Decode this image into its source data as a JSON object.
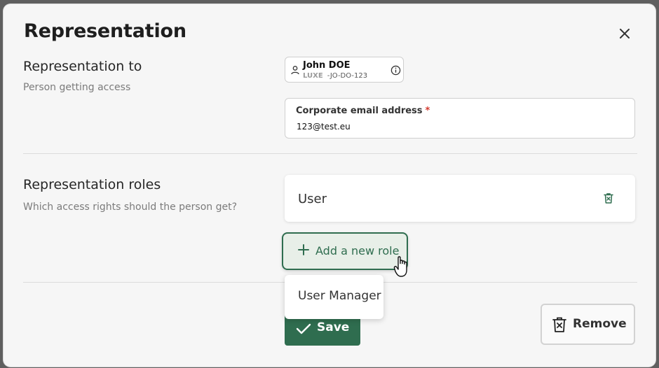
{
  "modal": {
    "title": "Representation"
  },
  "representation_to": {
    "title": "Representation to",
    "subtitle": "Person getting access",
    "person": {
      "name": "John DOE",
      "country": "LUXE",
      "code": "-JO-DO-123"
    },
    "email": {
      "label": "Corporate email address",
      "required_mark": "*",
      "value": "123@test.eu"
    }
  },
  "roles": {
    "title": "Representation roles",
    "subtitle": "Which access rights should the person get?",
    "items": [
      {
        "label": "User"
      }
    ],
    "add_label": "Add a new role",
    "dropdown_options": [
      "User Manager"
    ]
  },
  "actions": {
    "save_label": "Save",
    "remove_label": "Remove"
  },
  "colors": {
    "primary": "#2f6d4f",
    "required": "#d43a2f",
    "overlay": "#5f5f5f"
  }
}
